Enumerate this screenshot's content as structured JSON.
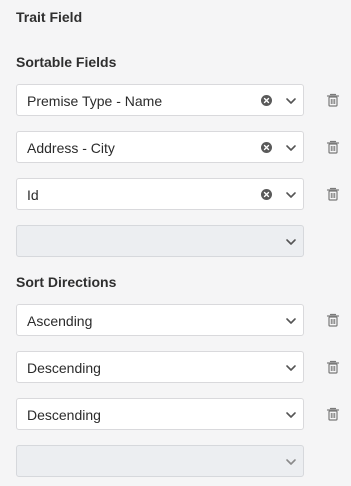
{
  "trait_field": {
    "title": "Trait Field"
  },
  "sortable_fields": {
    "title": "Sortable Fields",
    "items": [
      {
        "value": "Premise Type - Name"
      },
      {
        "value": "Address - City"
      },
      {
        "value": "Id"
      }
    ],
    "empty_value": ""
  },
  "sort_directions": {
    "title": "Sort Directions",
    "items": [
      {
        "value": "Ascending"
      },
      {
        "value": "Descending"
      },
      {
        "value": "Descending"
      }
    ],
    "empty_value": ""
  },
  "icons": {
    "clear": "clear-circle-icon",
    "chevron": "chevron-down-icon",
    "delete": "trash-icon"
  },
  "colors": {
    "background": "#f5f5f6",
    "field_background": "#ffffff",
    "empty_field_background": "#eceef1",
    "border": "#d9d9dc",
    "icon": "#555555"
  }
}
